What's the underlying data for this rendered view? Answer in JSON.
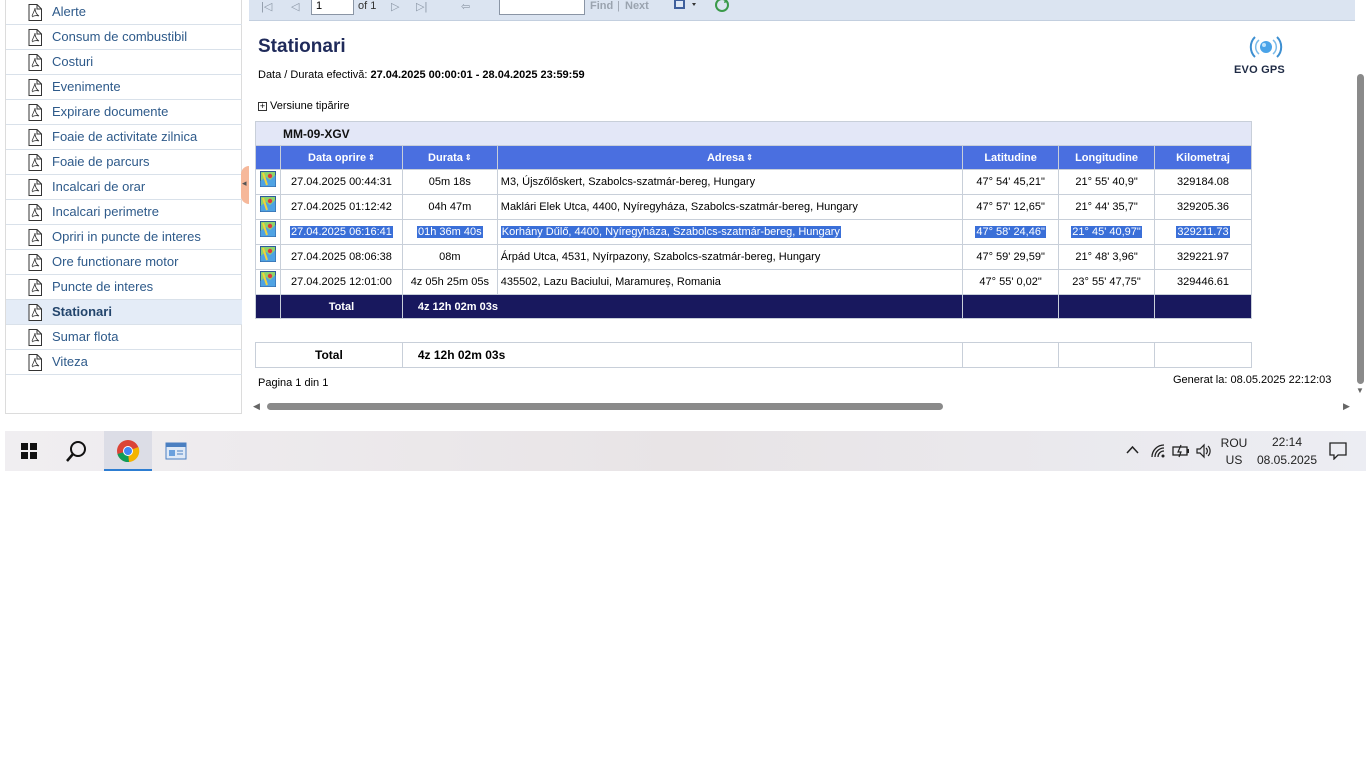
{
  "sidebar": {
    "items": [
      {
        "label": "Alerte",
        "active": false
      },
      {
        "label": "Consum de combustibil",
        "active": false
      },
      {
        "label": "Costuri",
        "active": false
      },
      {
        "label": "Evenimente",
        "active": false
      },
      {
        "label": "Expirare documente",
        "active": false
      },
      {
        "label": "Foaie de activitate zilnica",
        "active": false
      },
      {
        "label": "Foaie de parcurs",
        "active": false
      },
      {
        "label": "Incalcari de orar",
        "active": false
      },
      {
        "label": "Incalcari perimetre",
        "active": false
      },
      {
        "label": "Opriri in puncte de interes",
        "active": false
      },
      {
        "label": "Ore functionare motor",
        "active": false
      },
      {
        "label": "Puncte de interes",
        "active": false
      },
      {
        "label": "Stationari",
        "active": true
      },
      {
        "label": "Sumar flota",
        "active": false
      },
      {
        "label": "Viteza",
        "active": false
      }
    ]
  },
  "toolbar": {
    "page_value": "1",
    "of_label": "of 1",
    "find_label": "Find",
    "separator": "|",
    "next_label": "Next"
  },
  "report": {
    "title": "Stationari",
    "period_label": "Data / Durata efectivă:",
    "period_value": "27.04.2025 00:00:01 - 28.04.2025 23:59:59",
    "print_version": "Versiune tipărire",
    "logo_text": "EVO GPS",
    "vehicle": "MM-09-XGV",
    "columns": [
      "Data oprire",
      "Durata",
      "Adresa",
      "Latitudine",
      "Longitudine",
      "Kilometraj"
    ],
    "rows": [
      {
        "date": "27.04.2025 00:44:31",
        "duration": "05m 18s",
        "address": "M3,   Újszőlőskert, Szabolcs-szatmár-bereg, Hungary",
        "lat": "47° 54' 45,21\"",
        "lon": "21° 55' 40,9\"",
        "km": "329184.08",
        "selected": false
      },
      {
        "date": "27.04.2025 01:12:42",
        "duration": "04h 47m",
        "address": "Maklári Elek Utca,  4400, Nyíregyháza, Szabolcs-szatmár-bereg, Hungary",
        "lat": "47° 57' 12,65\"",
        "lon": "21° 44' 35,7\"",
        "km": "329205.36",
        "selected": false
      },
      {
        "date": "27.04.2025 06:16:41",
        "duration": "01h 36m 40s",
        "address": "Korhány Dűlő,  4400, Nyíregyháza, Szabolcs-szatmár-bereg, Hungary",
        "lat": "47° 58' 24,46\"",
        "lon": "21° 45' 40,97\"",
        "km": "329211.73",
        "selected": true
      },
      {
        "date": "27.04.2025 08:06:38",
        "duration": "08m",
        "address": "Árpád Utca,  4531, Nyírpazony, Szabolcs-szatmár-bereg, Hungary",
        "lat": "47° 59' 29,59\"",
        "lon": "21° 48' 3,96\"",
        "km": "329221.97",
        "selected": false
      },
      {
        "date": "27.04.2025 12:01:00",
        "duration": "4z 05h 25m 05s",
        "address": "435502, Lazu Baciului, Maramureș, Romania",
        "lat": "47° 55' 0,02\"",
        "lon": "23° 55' 47,75\"",
        "km": "329446.61",
        "selected": false
      }
    ],
    "total_label": "Total",
    "total_value": "4z 12h 02m 03s",
    "grand_total_label": "Total",
    "grand_total_value": "4z 12h 02m 03s",
    "page_info": "Pagina 1 din 1",
    "generated": "Generat la: 08.05.2025 22:12:03"
  },
  "taskbar": {
    "language_top": "ROU",
    "language_bottom": "US",
    "time": "22:14",
    "date": "08.05.2025"
  },
  "colors": {
    "header_blue": "#4a6fe0",
    "total_navy": "#18185e",
    "group_band": "#e3e7f7",
    "selection": "#3a6fd8"
  }
}
